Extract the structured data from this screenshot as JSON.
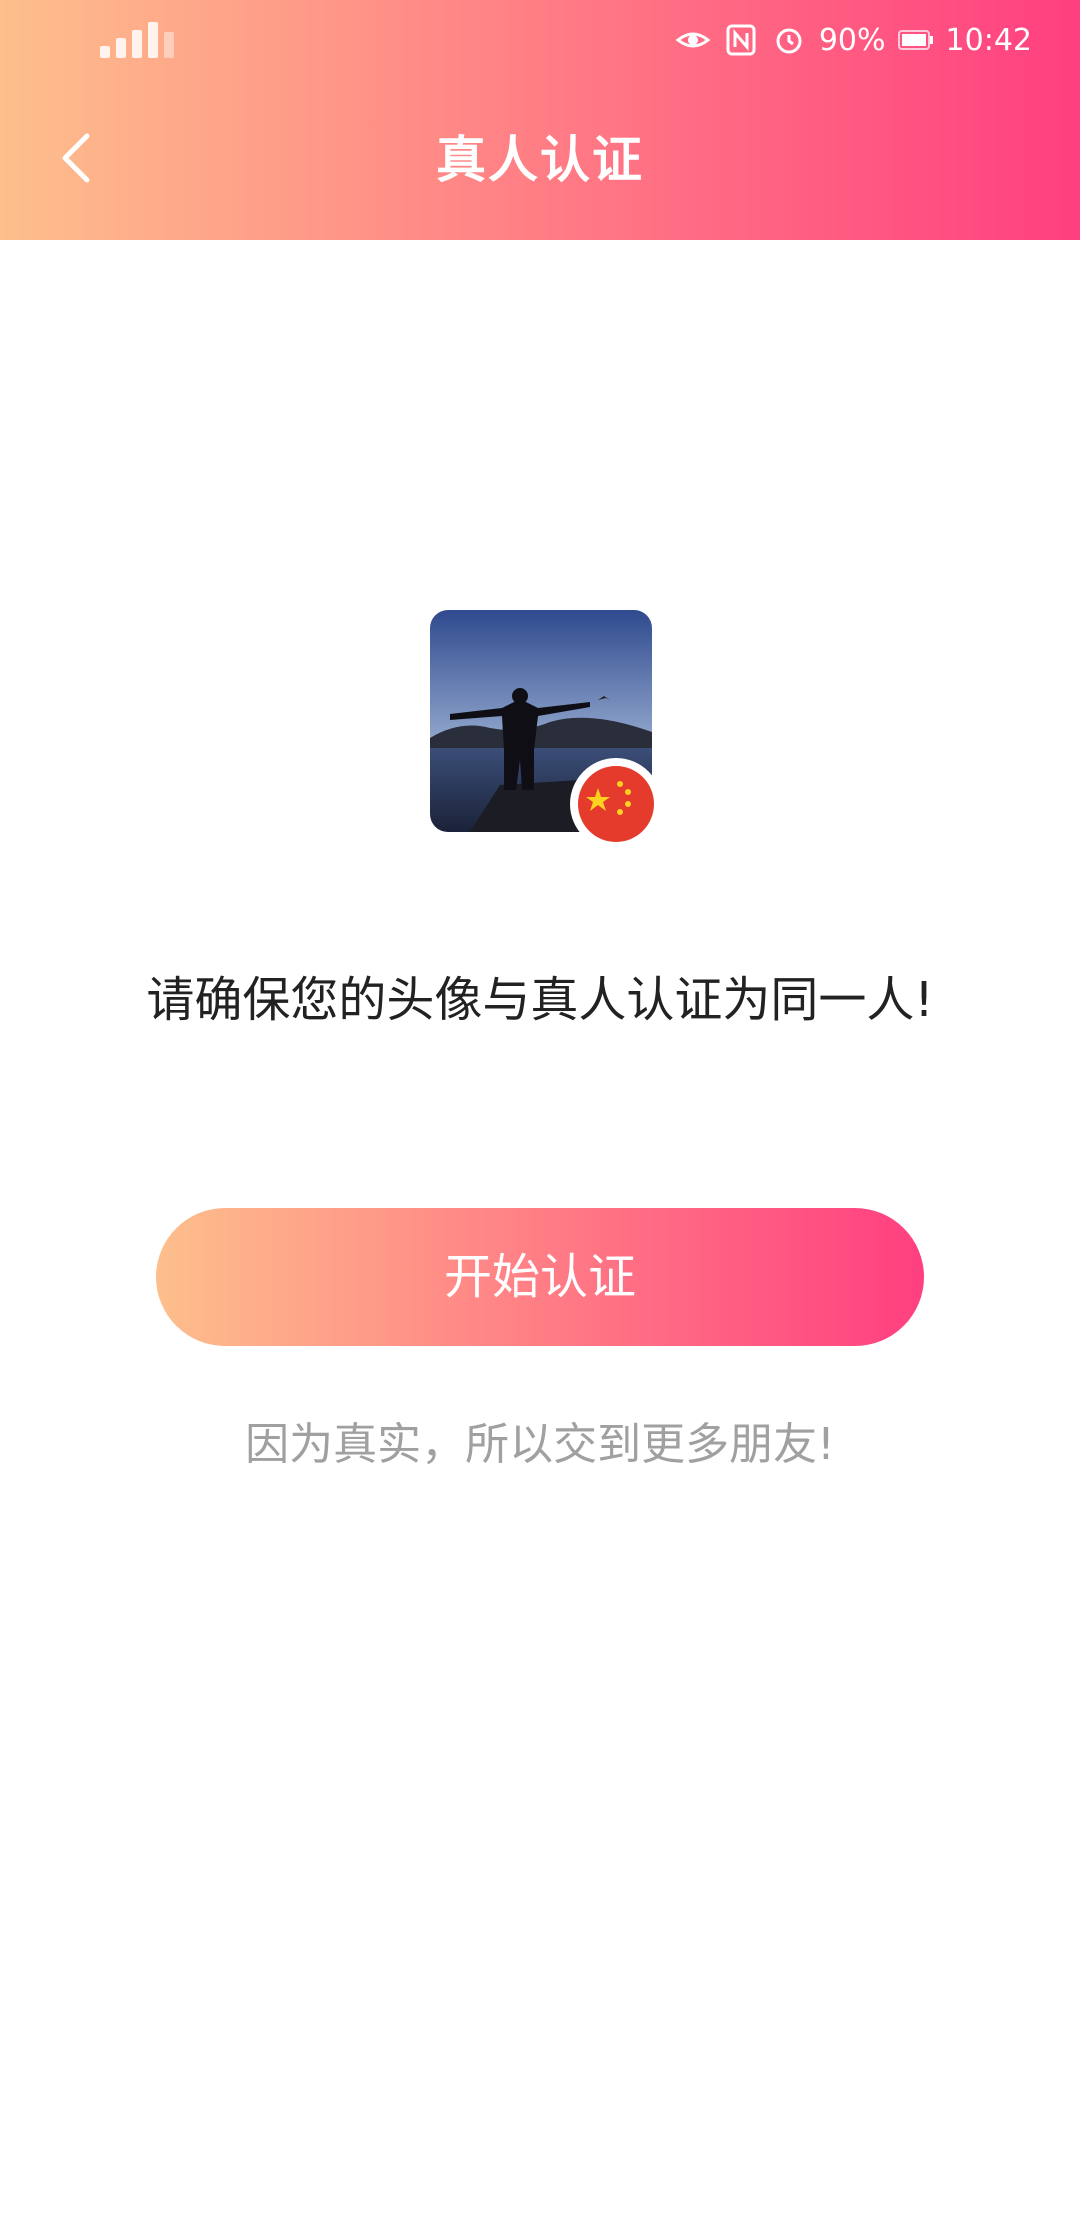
{
  "status_bar": {
    "battery": "90%",
    "time": "10:42",
    "icons": [
      "signal-icon",
      "eye-icon",
      "nfc-icon",
      "alarm-icon",
      "battery-icon"
    ]
  },
  "nav": {
    "title": "真人认证",
    "back_icon": "chevron-left-icon"
  },
  "avatar": {
    "badge_icon": "china-flag-icon"
  },
  "notice": "请确保您的头像与真人认证为同一人!",
  "start_button_label": "开始认证",
  "slogan": "因为真实，所以交到更多朋友!",
  "colors": {
    "gradient_start": "#fdbf8c",
    "gradient_mid": "#ff8a86",
    "gradient_end": "#ff3f80",
    "notice_text": "#222222",
    "slogan_text": "#a0a0a0"
  }
}
